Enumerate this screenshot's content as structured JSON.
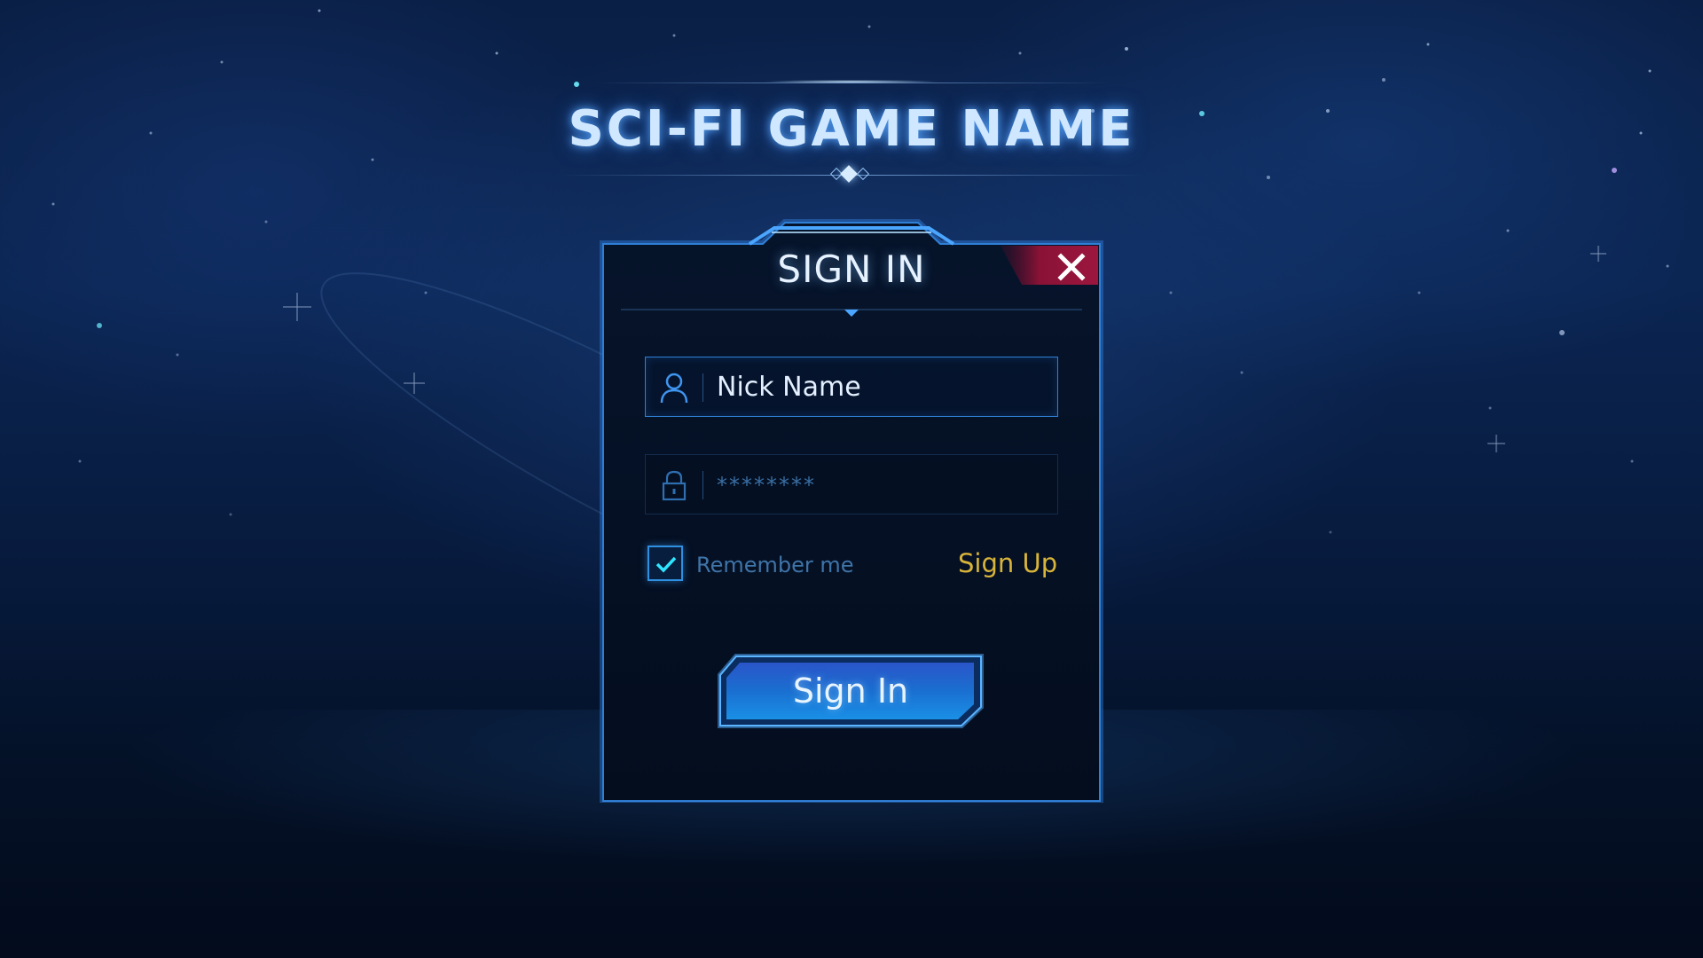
{
  "game": {
    "title": "SCI-FI GAME NAME"
  },
  "dialog": {
    "title": "SIGN IN",
    "close_icon": "close-icon",
    "nickname": {
      "icon": "user-icon",
      "value": "Nick Name"
    },
    "password": {
      "icon": "lock-icon",
      "masked_value": "********"
    },
    "remember": {
      "label": "Remember me",
      "checked": true,
      "icon": "check-icon"
    },
    "signup_label": "Sign Up",
    "signin_label": "Sign In"
  },
  "colors": {
    "accent": "#2f7fd6",
    "close": "#8a1236",
    "link": "#d8b43a",
    "button": "#1a6fd0"
  }
}
